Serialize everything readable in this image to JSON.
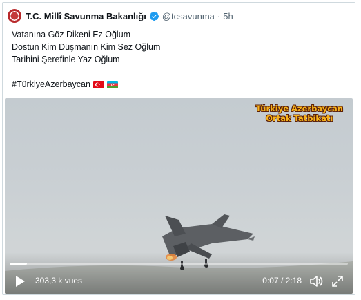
{
  "tweet": {
    "author_name": "T.C. Millî Savunma Bakanlığı",
    "handle": "@tcsavunma",
    "separator": "·",
    "time": "5h",
    "lines": [
      "Vatanına Göz Dikeni Ez Oğlum",
      "Dostun Kim Düşmanın Kim Sez Oğlum",
      "Tarihini Şerefinle Yaz Oğlum"
    ],
    "hashtag": "#TürkiyeAzerbaycan"
  },
  "video": {
    "caption_line1": "Türkiye Azerbaycan",
    "caption_line2": "Ortak Tatbikatı",
    "views": "303,3 k vues",
    "timer": "0:07 / 2:18",
    "progress_fraction": 0.05
  },
  "icons": {
    "verified": "verified-badge-icon",
    "play": "play-icon",
    "volume": "volume-icon",
    "fullscreen": "fullscreen-icon"
  },
  "colors": {
    "verified_blue": "#1d9bf0",
    "muted_text": "#536471",
    "caption_gold": "#f7b21a"
  }
}
